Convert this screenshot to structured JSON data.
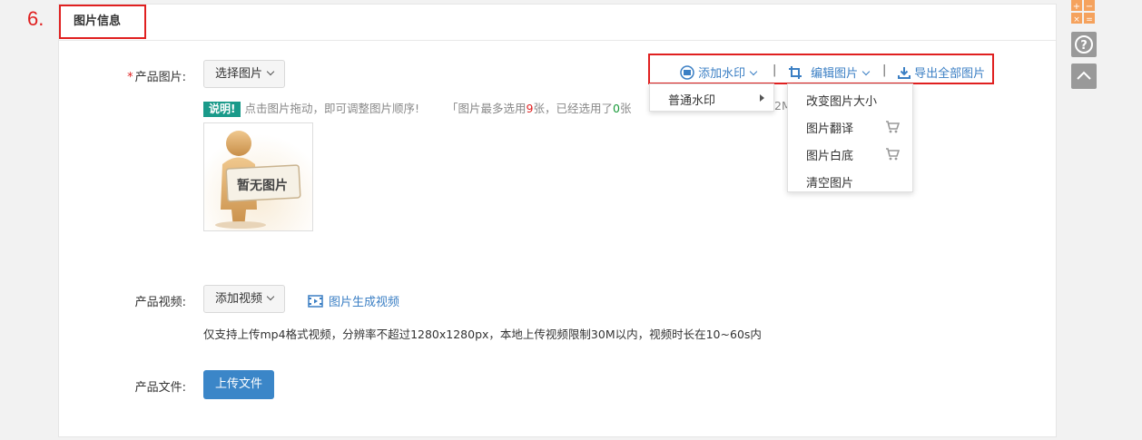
{
  "step_number": "6.",
  "section": {
    "title": "图片信息"
  },
  "image_row": {
    "label": "产品图片:",
    "required_mark": "*",
    "select_button": "选择图片",
    "tip_badge": "说明!",
    "tip_text": "点击图片拖动，即可调整图片顺序!",
    "tip_limit_prefix": "「图片最多选用",
    "tip_limit_max": "9",
    "tip_limit_mid": "张，已经选用了",
    "tip_limit_used": "0",
    "tip_limit_suffix": "张",
    "tip_trailing": "2M",
    "placeholder_text": "暂无图片"
  },
  "toolbar": {
    "watermark_label": "添加水印",
    "edit_label": "编辑图片",
    "export_label": "导出全部图片",
    "separator": "|"
  },
  "watermark_menu": {
    "items": [
      "普通水印"
    ]
  },
  "edit_menu": {
    "items": [
      "改变图片大小",
      "图片翻译",
      "图片白底",
      "清空图片"
    ]
  },
  "video_row": {
    "label": "产品视频:",
    "add_button": "添加视频",
    "generate_link": "图片生成视频",
    "note": "仅支持上传mp4格式视频，分辨率不超过1280x1280px，本地上传视频限制30M以内，视频时长在10~60s内"
  },
  "file_row": {
    "label": "产品文件:",
    "upload_button": "上传文件"
  },
  "colors": {
    "accent": "#3b7fc4",
    "highlight": "#e02020",
    "badge": "#1a9a8a",
    "primary_button": "#3b86c8"
  }
}
